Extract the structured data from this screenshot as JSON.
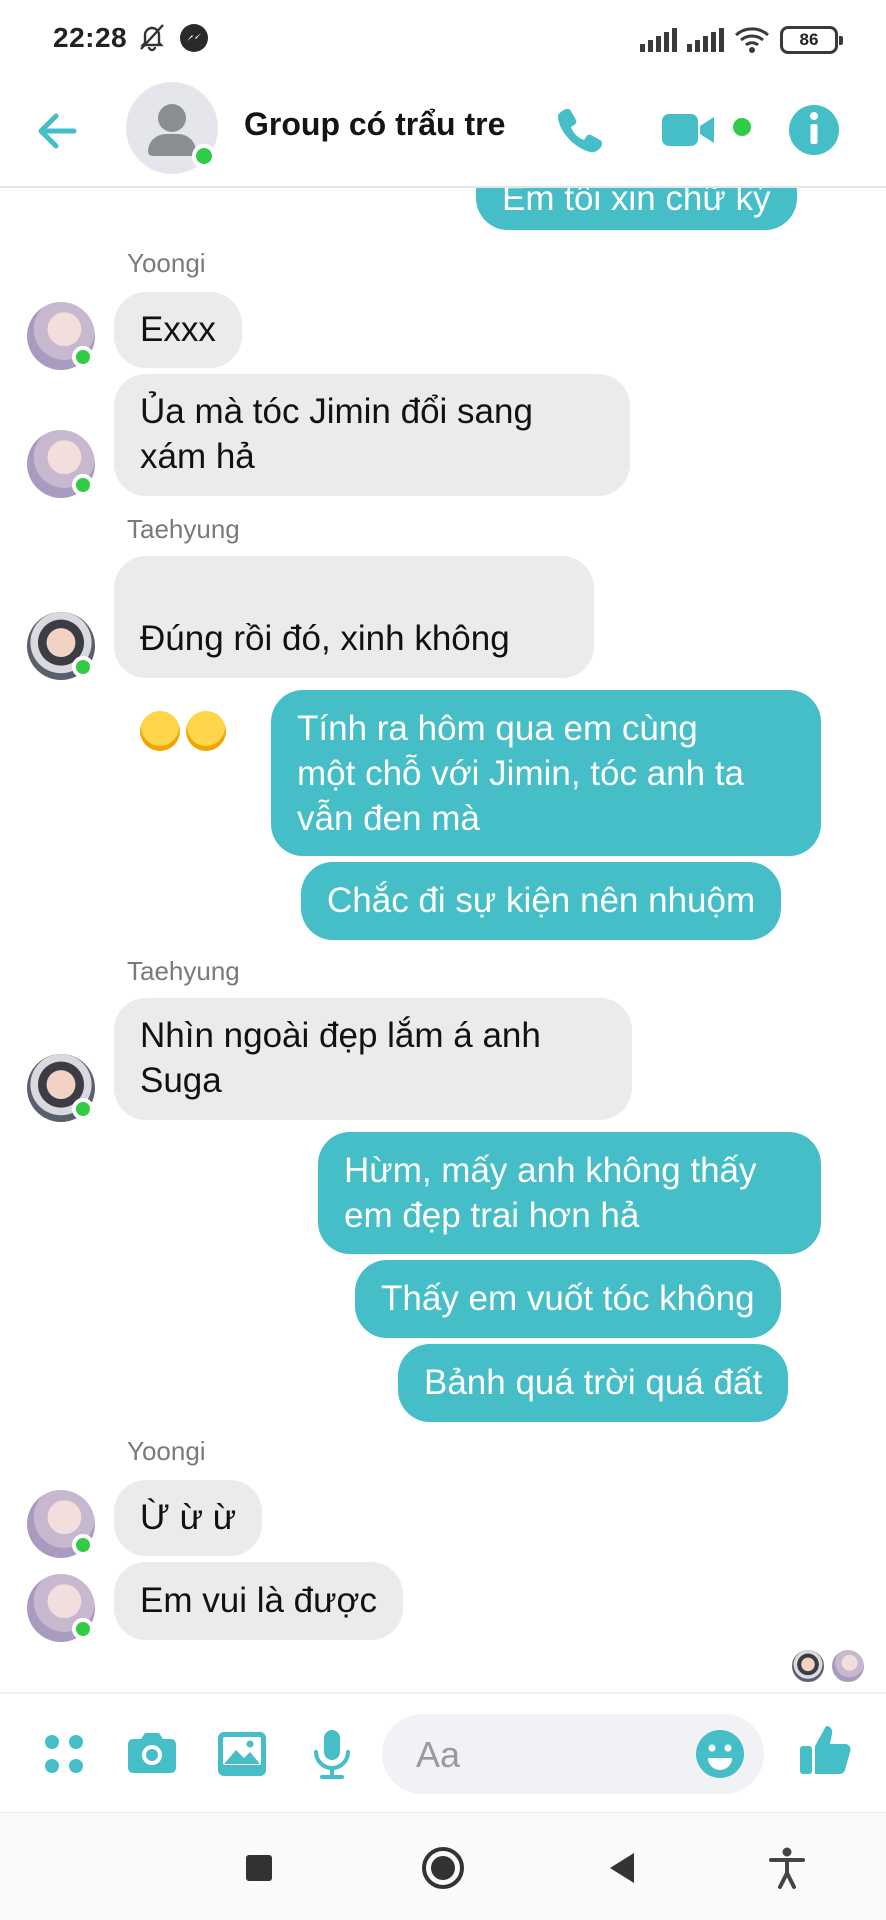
{
  "status_bar": {
    "time": "22:28",
    "battery": "86",
    "icons": [
      "bell-muted-icon",
      "messenger-icon",
      "signal-icon",
      "signal-icon",
      "wifi-icon",
      "battery-icon"
    ]
  },
  "header": {
    "title": "Group có trẩu tre",
    "icons": [
      "back-arrow-icon",
      "group-avatar-icon",
      "phone-icon",
      "video-icon",
      "info-icon"
    ],
    "accent_color": "#45bec7"
  },
  "messages": [
    {
      "id": "m0",
      "side": "out",
      "text": "Em tôi xin chữ ký"
    },
    {
      "id": "s1",
      "sender": "Yoongi"
    },
    {
      "id": "m1",
      "side": "in",
      "sender": "Yoongi",
      "text": "Exxx"
    },
    {
      "id": "m2",
      "side": "in",
      "sender": "Yoongi",
      "text": "Ủa mà tóc Jimin đổi sang\nxám hả"
    },
    {
      "id": "s2",
      "sender": "Taehyung"
    },
    {
      "id": "m3",
      "side": "in",
      "sender": "Taehyung",
      "text": "Đúng rồi đó, xinh không",
      "emoji": [
        "rofl-emoji",
        "rofl-emoji"
      ]
    },
    {
      "id": "m4",
      "side": "out",
      "text": "Tính ra hôm qua em cùng\nmột chỗ với Jimin, tóc anh ta\nvẫn đen mà"
    },
    {
      "id": "m5",
      "side": "out",
      "text": "Chắc đi sự kiện nên nhuộm"
    },
    {
      "id": "s3",
      "sender": "Taehyung"
    },
    {
      "id": "m6",
      "side": "in",
      "sender": "Taehyung",
      "text": "Nhìn ngoài đẹp lắm á anh\nSuga"
    },
    {
      "id": "m7",
      "side": "out",
      "text": "Hừm, mấy anh không thấy\nem đẹp trai hơn hả"
    },
    {
      "id": "m8",
      "side": "out",
      "text": "Thấy em vuốt tóc không"
    },
    {
      "id": "m9",
      "side": "out",
      "text": "Bảnh quá trời quá đất"
    },
    {
      "id": "s4",
      "sender": "Yoongi"
    },
    {
      "id": "m10",
      "side": "in",
      "sender": "Yoongi",
      "text": "Ừ ừ ừ"
    },
    {
      "id": "m11",
      "side": "in",
      "sender": "Yoongi",
      "text": "Em vui là được"
    }
  ],
  "seen_by": [
    "Taehyung",
    "Yoongi"
  ],
  "composer": {
    "placeholder": "Aa",
    "icons": [
      "menu-dots-icon",
      "camera-icon",
      "gallery-icon",
      "microphone-icon",
      "emoji-icon",
      "thumbs-up-icon"
    ]
  },
  "navbar": {
    "icons": [
      "recent-apps-icon",
      "home-icon",
      "back-icon",
      "accessibility-icon"
    ]
  }
}
